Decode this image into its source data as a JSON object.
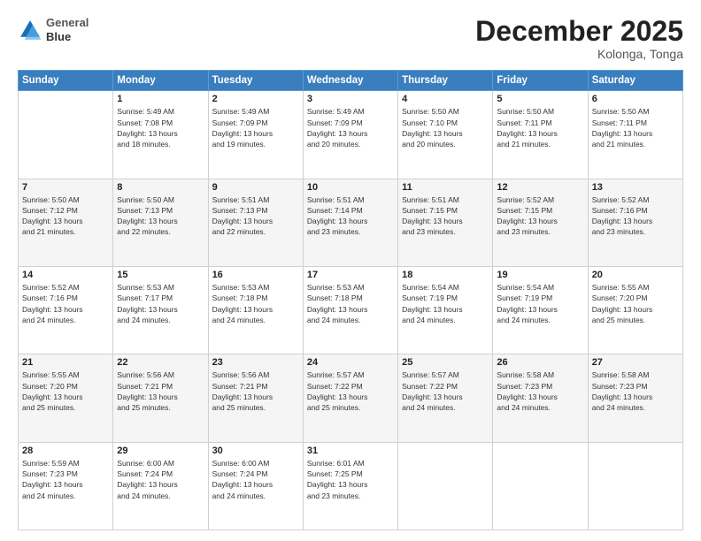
{
  "header": {
    "logo": {
      "line1": "General",
      "line2": "Blue"
    },
    "title": "December 2025",
    "location": "Kolonga, Tonga"
  },
  "weekdays": [
    "Sunday",
    "Monday",
    "Tuesday",
    "Wednesday",
    "Thursday",
    "Friday",
    "Saturday"
  ],
  "weeks": [
    [
      {
        "day": "",
        "info": ""
      },
      {
        "day": "1",
        "info": "Sunrise: 5:49 AM\nSunset: 7:08 PM\nDaylight: 13 hours\nand 18 minutes."
      },
      {
        "day": "2",
        "info": "Sunrise: 5:49 AM\nSunset: 7:09 PM\nDaylight: 13 hours\nand 19 minutes."
      },
      {
        "day": "3",
        "info": "Sunrise: 5:49 AM\nSunset: 7:09 PM\nDaylight: 13 hours\nand 20 minutes."
      },
      {
        "day": "4",
        "info": "Sunrise: 5:50 AM\nSunset: 7:10 PM\nDaylight: 13 hours\nand 20 minutes."
      },
      {
        "day": "5",
        "info": "Sunrise: 5:50 AM\nSunset: 7:11 PM\nDaylight: 13 hours\nand 21 minutes."
      },
      {
        "day": "6",
        "info": "Sunrise: 5:50 AM\nSunset: 7:11 PM\nDaylight: 13 hours\nand 21 minutes."
      }
    ],
    [
      {
        "day": "7",
        "info": "Sunrise: 5:50 AM\nSunset: 7:12 PM\nDaylight: 13 hours\nand 21 minutes."
      },
      {
        "day": "8",
        "info": "Sunrise: 5:50 AM\nSunset: 7:13 PM\nDaylight: 13 hours\nand 22 minutes."
      },
      {
        "day": "9",
        "info": "Sunrise: 5:51 AM\nSunset: 7:13 PM\nDaylight: 13 hours\nand 22 minutes."
      },
      {
        "day": "10",
        "info": "Sunrise: 5:51 AM\nSunset: 7:14 PM\nDaylight: 13 hours\nand 23 minutes."
      },
      {
        "day": "11",
        "info": "Sunrise: 5:51 AM\nSunset: 7:15 PM\nDaylight: 13 hours\nand 23 minutes."
      },
      {
        "day": "12",
        "info": "Sunrise: 5:52 AM\nSunset: 7:15 PM\nDaylight: 13 hours\nand 23 minutes."
      },
      {
        "day": "13",
        "info": "Sunrise: 5:52 AM\nSunset: 7:16 PM\nDaylight: 13 hours\nand 23 minutes."
      }
    ],
    [
      {
        "day": "14",
        "info": "Sunrise: 5:52 AM\nSunset: 7:16 PM\nDaylight: 13 hours\nand 24 minutes."
      },
      {
        "day": "15",
        "info": "Sunrise: 5:53 AM\nSunset: 7:17 PM\nDaylight: 13 hours\nand 24 minutes."
      },
      {
        "day": "16",
        "info": "Sunrise: 5:53 AM\nSunset: 7:18 PM\nDaylight: 13 hours\nand 24 minutes."
      },
      {
        "day": "17",
        "info": "Sunrise: 5:53 AM\nSunset: 7:18 PM\nDaylight: 13 hours\nand 24 minutes."
      },
      {
        "day": "18",
        "info": "Sunrise: 5:54 AM\nSunset: 7:19 PM\nDaylight: 13 hours\nand 24 minutes."
      },
      {
        "day": "19",
        "info": "Sunrise: 5:54 AM\nSunset: 7:19 PM\nDaylight: 13 hours\nand 24 minutes."
      },
      {
        "day": "20",
        "info": "Sunrise: 5:55 AM\nSunset: 7:20 PM\nDaylight: 13 hours\nand 25 minutes."
      }
    ],
    [
      {
        "day": "21",
        "info": "Sunrise: 5:55 AM\nSunset: 7:20 PM\nDaylight: 13 hours\nand 25 minutes."
      },
      {
        "day": "22",
        "info": "Sunrise: 5:56 AM\nSunset: 7:21 PM\nDaylight: 13 hours\nand 25 minutes."
      },
      {
        "day": "23",
        "info": "Sunrise: 5:56 AM\nSunset: 7:21 PM\nDaylight: 13 hours\nand 25 minutes."
      },
      {
        "day": "24",
        "info": "Sunrise: 5:57 AM\nSunset: 7:22 PM\nDaylight: 13 hours\nand 25 minutes."
      },
      {
        "day": "25",
        "info": "Sunrise: 5:57 AM\nSunset: 7:22 PM\nDaylight: 13 hours\nand 24 minutes."
      },
      {
        "day": "26",
        "info": "Sunrise: 5:58 AM\nSunset: 7:23 PM\nDaylight: 13 hours\nand 24 minutes."
      },
      {
        "day": "27",
        "info": "Sunrise: 5:58 AM\nSunset: 7:23 PM\nDaylight: 13 hours\nand 24 minutes."
      }
    ],
    [
      {
        "day": "28",
        "info": "Sunrise: 5:59 AM\nSunset: 7:23 PM\nDaylight: 13 hours\nand 24 minutes."
      },
      {
        "day": "29",
        "info": "Sunrise: 6:00 AM\nSunset: 7:24 PM\nDaylight: 13 hours\nand 24 minutes."
      },
      {
        "day": "30",
        "info": "Sunrise: 6:00 AM\nSunset: 7:24 PM\nDaylight: 13 hours\nand 24 minutes."
      },
      {
        "day": "31",
        "info": "Sunrise: 6:01 AM\nSunset: 7:25 PM\nDaylight: 13 hours\nand 23 minutes."
      },
      {
        "day": "",
        "info": ""
      },
      {
        "day": "",
        "info": ""
      },
      {
        "day": "",
        "info": ""
      }
    ]
  ]
}
